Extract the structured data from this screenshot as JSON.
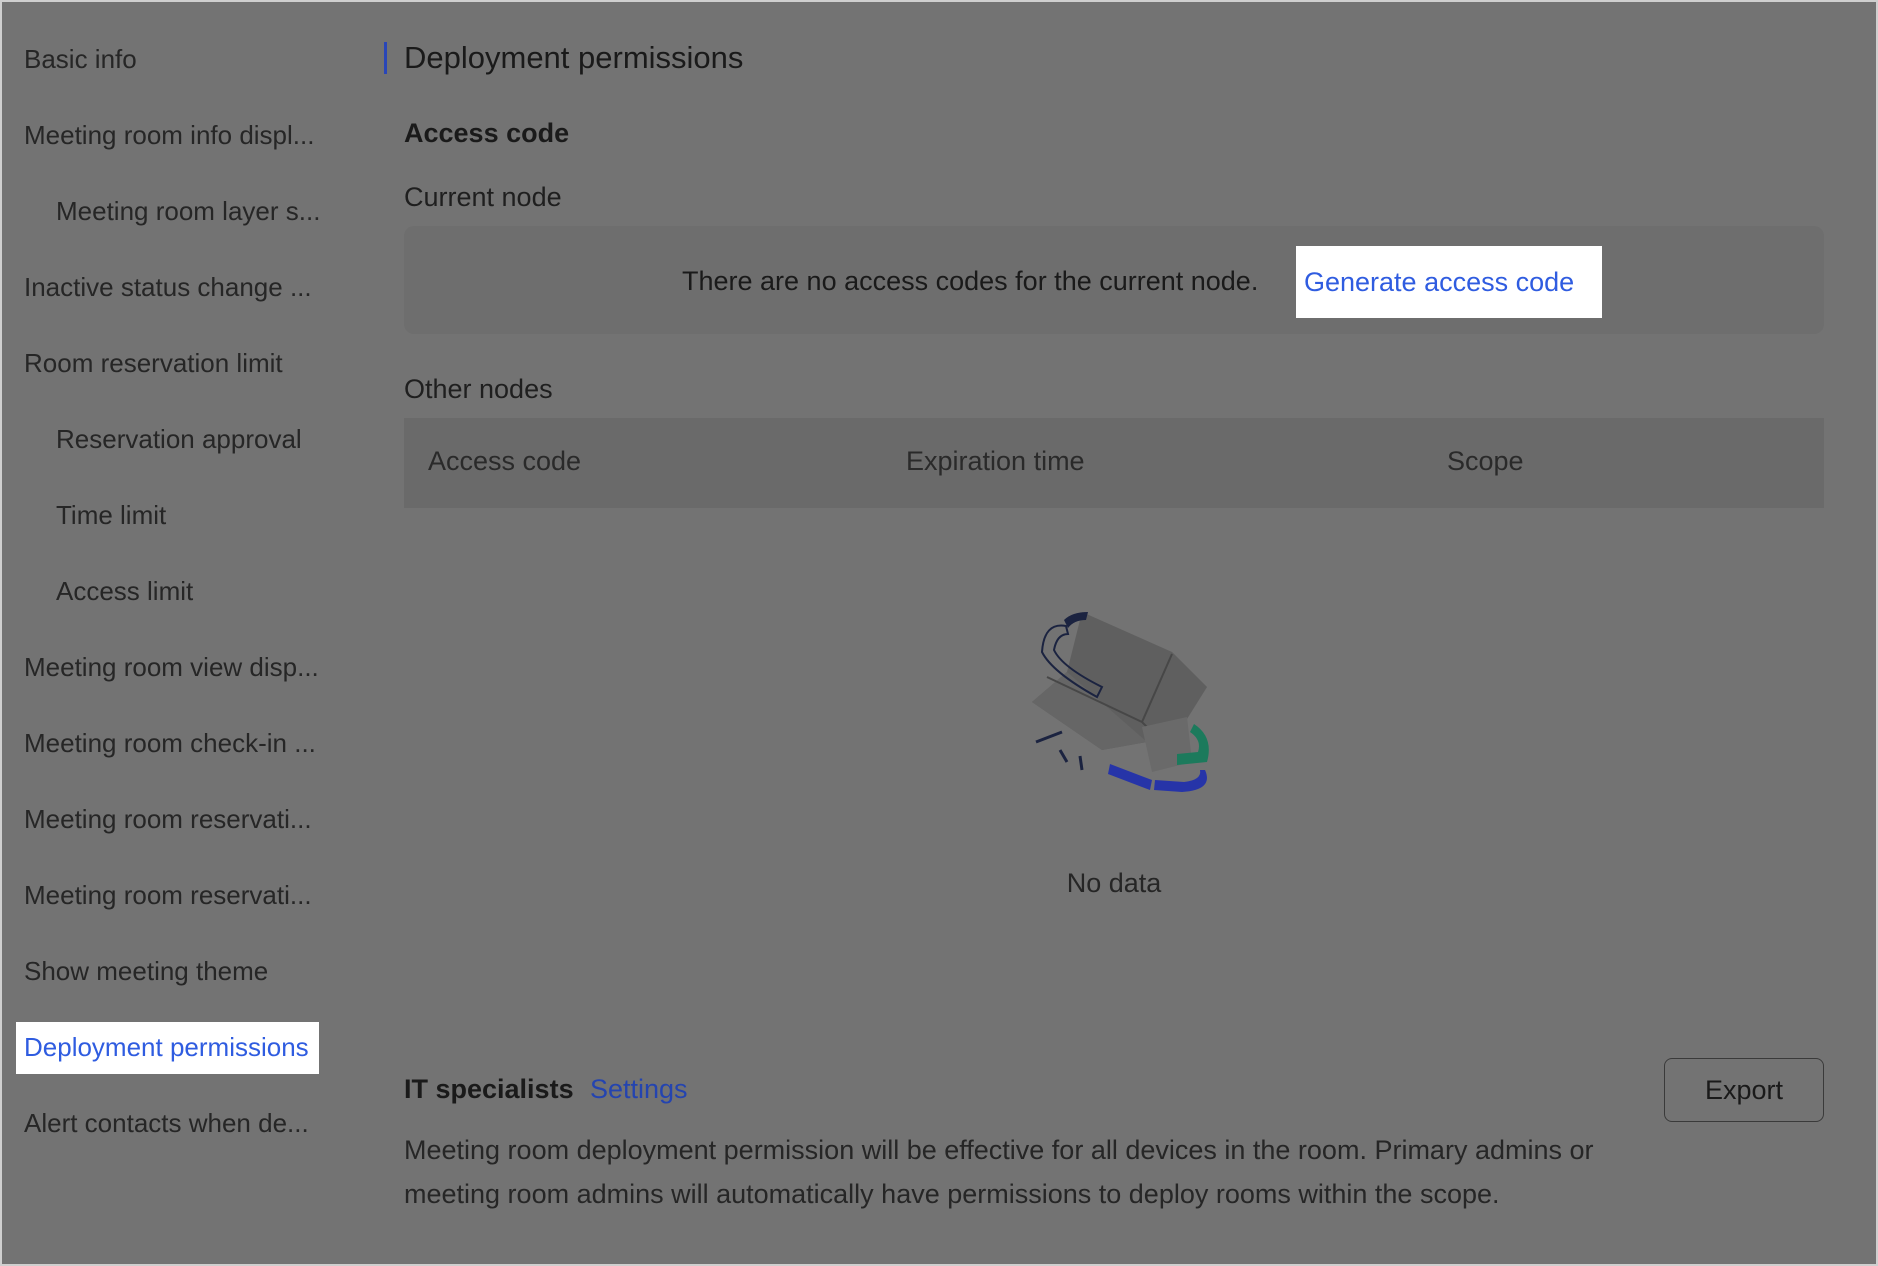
{
  "sidebar": {
    "items": [
      {
        "label": "Basic info",
        "sub": false
      },
      {
        "label": "Meeting room info displ...",
        "sub": false
      },
      {
        "label": "Meeting room layer s...",
        "sub": true
      },
      {
        "label": "Inactive status change ...",
        "sub": false
      },
      {
        "label": "Room reservation limit",
        "sub": false
      },
      {
        "label": "Reservation approval",
        "sub": true
      },
      {
        "label": "Time limit",
        "sub": true
      },
      {
        "label": "Access limit",
        "sub": true
      },
      {
        "label": "Meeting room view disp...",
        "sub": false
      },
      {
        "label": "Meeting room check-in ...",
        "sub": false
      },
      {
        "label": "Meeting room reservati...",
        "sub": false
      },
      {
        "label": "Meeting room reservati...",
        "sub": false
      },
      {
        "label": "Show meeting theme",
        "sub": false
      },
      {
        "label": "Deployment permissions",
        "sub": false,
        "active": true
      },
      {
        "label": "Alert contacts when de...",
        "sub": false
      }
    ]
  },
  "main": {
    "title": "Deployment permissions",
    "access_code_title": "Access code",
    "current_node_label": "Current node",
    "current_node_message": "There are no access codes for the current node.",
    "generate_label": "Generate access code",
    "other_nodes_label": "Other nodes",
    "table_headers": [
      "Access code",
      "Expiration time",
      "Scope"
    ],
    "empty_text": "No data",
    "it_title": "IT specialists",
    "it_settings": "Settings",
    "export_label": "Export",
    "note": "Meeting room deployment permission will be effective for all devices in the room. Primary admins or meeting room admins will automatically have permissions to deploy rooms within the scope."
  },
  "colors": {
    "overlay": "#737373",
    "link": "#2f5ce0",
    "accent_bar": "#2946b8"
  }
}
